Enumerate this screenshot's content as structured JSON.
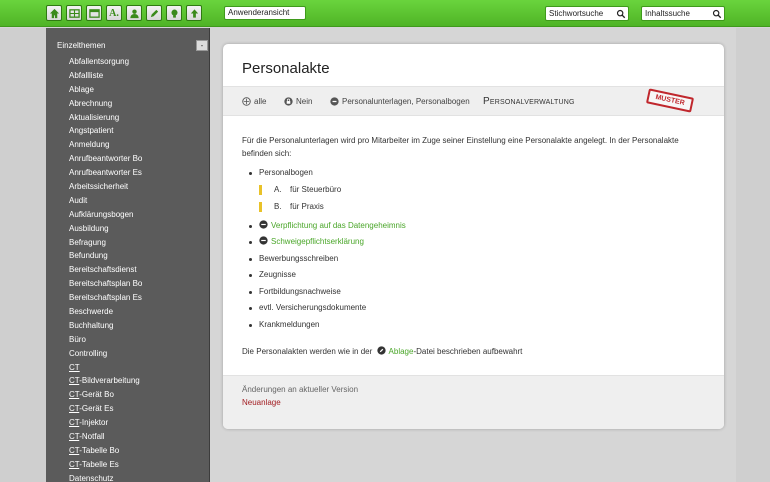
{
  "toolbar": {
    "buttons": [
      {
        "name": "home-icon"
      },
      {
        "name": "grid-icon"
      },
      {
        "name": "window-icon"
      },
      {
        "name": "text-a-icon",
        "label": "A."
      },
      {
        "name": "user-icon"
      },
      {
        "name": "pencil-icon"
      },
      {
        "name": "bulb-icon"
      },
      {
        "name": "upload-arrow-icon"
      }
    ],
    "view_select": "Anwenderansicht",
    "search_keyword_placeholder": "Stichwortsuche",
    "search_content_placeholder": "Inhaltssuche",
    "colors": {
      "bar": "#5ac32f",
      "accent": "#4aa629"
    }
  },
  "sidebar": {
    "heading": "Einzelthemen",
    "collapse": "-",
    "items": [
      "Abfallentsorgung",
      "Abfallliste",
      "Ablage",
      "Abrechnung",
      "Aktualisierung",
      "Angstpatient",
      "Anmeldung",
      "Anrufbeantworter Bo",
      "Anrufbeantworter Es",
      "Arbeitssicherheit",
      "Audit",
      "Aufklärungsbogen",
      "Ausbildung",
      "Befragung",
      "Befundung",
      "Bereitschaftsdienst",
      "Bereitschaftsplan Bo",
      "Bereitschaftsplan Es",
      "Beschwerde",
      "Buchhaltung",
      "Büro",
      "Controlling",
      "CT",
      "CT-Bildverarbeitung",
      "CT-Gerät Bo",
      "CT-Gerät Es",
      "CT-Injektor",
      "CT-Notfall",
      "CT-Tabelle Bo",
      "CT-Tabelle Es",
      "Datenschutz"
    ]
  },
  "page": {
    "title": "Personalakte",
    "meta": {
      "scope": "alle",
      "privacy": "Nein",
      "related": "Personalunterlagen, Personalbogen",
      "category": "Personalverwaltung",
      "stamp": "MUSTER"
    },
    "intro": "Für die Personalunterlagen wird pro Mitarbeiter im Zuge seiner Einstellung eine Personalakte angelegt. In der Personalakte befinden sich:",
    "list": {
      "personalbogen": "Personalbogen",
      "sub": [
        {
          "letter": "A.",
          "text": "für Steuerbüro"
        },
        {
          "letter": "B.",
          "text": "für Praxis"
        }
      ],
      "link1": "Verpflichtung auf das Datengeheimnis",
      "link2": "Schweigepflichtserklärung",
      "items": [
        "Bewerbungsschreiben",
        "Zeugnisse",
        "Fortbildungsnachweise",
        "evtl. Versicherungsdokumente",
        "Krankmeldungen"
      ]
    },
    "closing": {
      "before": "Die Personalakten werden wie in der",
      "link": "Ablage",
      "after": "-Datei beschrieben aufbewahrt"
    },
    "changes_label": "Änderungen an aktueller Version",
    "changes_value": "Neuanlage"
  }
}
